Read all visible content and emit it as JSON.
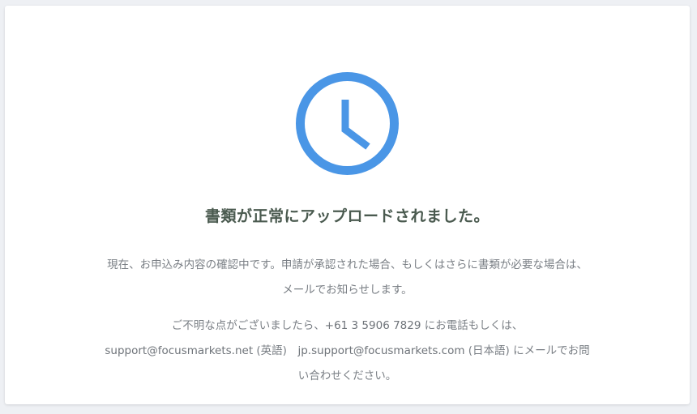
{
  "status_icon": "clock-icon",
  "accent_color": "#4a96e6",
  "title": "書類が正常にアップロードされました。",
  "message": {
    "line1": "現在、お申込み内容の確認中です。申請が承認された場合、もしくはさらに書類が必要な場合は、",
    "line2": "メールでお知らせします。"
  },
  "contact": {
    "line1_prefix": "ご不明な点がございましたら、",
    "phone": "+61 3 5906 7829",
    "line1_suffix": " にお電話もしくは、",
    "email_en": "support@focusmarkets.net",
    "email_en_note": " (英語)　",
    "email_jp": "jp.support@focusmarkets.com",
    "email_jp_note": " (日本語) にメールでお問",
    "line3": "い合わせください。"
  }
}
